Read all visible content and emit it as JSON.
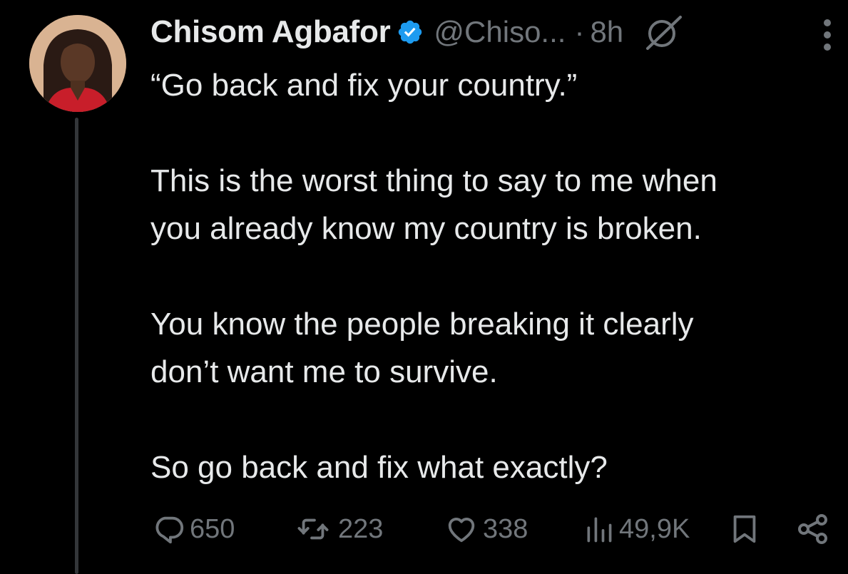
{
  "tweet": {
    "author": {
      "name": "Chisom Agbafor",
      "handle": "@Chiso...",
      "verified_icon": "verified-badge-icon"
    },
    "separator": "·",
    "time": "8h",
    "paragraphs": [
      "“Go back and fix your country.”",
      "This is the worst thing to say to me when\nyou already know my country is broken.",
      "You know the people breaking it clearly\ndon’t want me to survive.",
      "So go back and fix what exactly?"
    ],
    "actions": {
      "replies": "650",
      "reposts": "223",
      "likes": "338",
      "views": "49,9K"
    }
  },
  "colors": {
    "background": "#000000",
    "text": "#e7e9ea",
    "muted": "#71767b",
    "verified": "#1d9bf0",
    "thread_line": "#333639"
  },
  "icons": [
    "verified-badge-icon",
    "grok-icon",
    "more-icon",
    "reply-icon",
    "repost-icon",
    "like-icon",
    "views-icon",
    "bookmark-icon",
    "share-icon"
  ]
}
